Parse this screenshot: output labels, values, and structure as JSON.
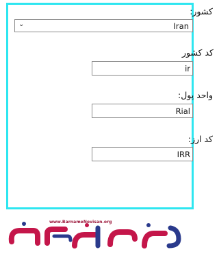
{
  "form": {
    "country_label": "کشور:",
    "country_value": "Iran",
    "country_code_label": "کد کشور",
    "country_code_value": "ir",
    "currency_unit_label": "واحد پول:",
    "currency_unit_value": "Rial",
    "currency_code_label": "کد ارز:",
    "currency_code_value": "IRR"
  },
  "logo": {
    "url_text": "www.BarnameNevisan.org"
  },
  "colors": {
    "panel_border": "#2ee6f0",
    "logo_primary": "#c4164a",
    "logo_secondary": "#2a3a8c"
  }
}
